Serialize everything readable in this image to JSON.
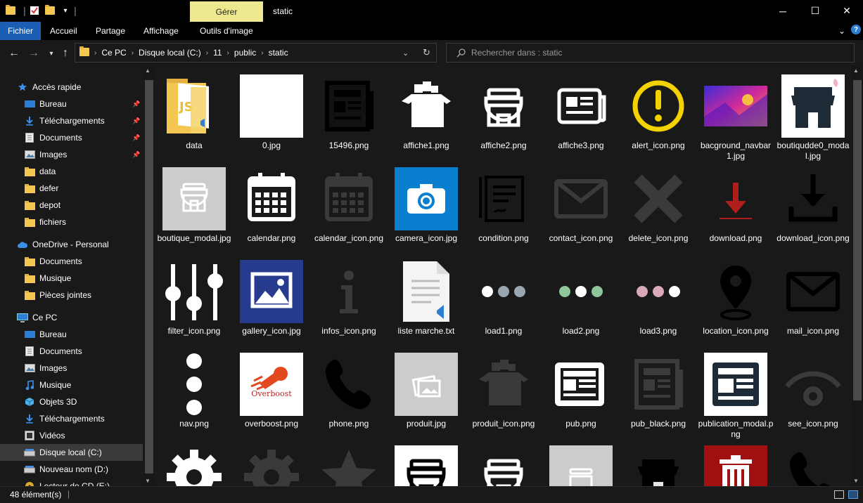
{
  "window": {
    "title": "static",
    "manage_tab": "Gérer",
    "minimize": "─",
    "maximize": "☐",
    "close": "✕"
  },
  "ribbon": {
    "tabs": [
      "Fichier",
      "Accueil",
      "Partage",
      "Affichage",
      "Outils d'image"
    ]
  },
  "address": {
    "crumbs": [
      "Ce PC",
      "Disque local (C:)",
      "11",
      "public",
      "static"
    ]
  },
  "search": {
    "placeholder": "Rechercher dans : static"
  },
  "sidebar": {
    "items": [
      {
        "label": "Accès rapide",
        "icon": "star-icon"
      },
      {
        "label": "Bureau",
        "icon": "desktop-icon",
        "pinned": true
      },
      {
        "label": "Téléchargements",
        "icon": "download-icon",
        "pinned": true
      },
      {
        "label": "Documents",
        "icon": "document-icon",
        "pinned": true
      },
      {
        "label": "Images",
        "icon": "images-icon",
        "pinned": true
      },
      {
        "label": "data",
        "icon": "folder-icon"
      },
      {
        "label": "defer",
        "icon": "folder-icon"
      },
      {
        "label": "depot",
        "icon": "folder-icon"
      },
      {
        "label": "fichiers",
        "icon": "folder-icon"
      },
      {
        "label": "OneDrive - Personal",
        "icon": "cloud-icon"
      },
      {
        "label": "Documents",
        "icon": "folder-icon"
      },
      {
        "label": "Musique",
        "icon": "folder-icon"
      },
      {
        "label": "Pièces jointes",
        "icon": "folder-icon"
      },
      {
        "label": "Ce PC",
        "icon": "computer-icon"
      },
      {
        "label": "Bureau",
        "icon": "desktop-icon"
      },
      {
        "label": "Documents",
        "icon": "document-icon"
      },
      {
        "label": "Images",
        "icon": "images-icon"
      },
      {
        "label": "Musique",
        "icon": "music-icon"
      },
      {
        "label": "Objets 3D",
        "icon": "cube-icon"
      },
      {
        "label": "Téléchargements",
        "icon": "download-icon"
      },
      {
        "label": "Vidéos",
        "icon": "video-icon"
      },
      {
        "label": "Disque local (C:)",
        "icon": "drive-icon",
        "selected": true
      },
      {
        "label": "Nouveau nom (D:)",
        "icon": "drive-icon"
      },
      {
        "label": "Lecteur de CD (E:)",
        "icon": "cd-icon"
      }
    ]
  },
  "files": [
    {
      "name": "data",
      "icon": "folder-icon"
    },
    {
      "name": "0.jpg",
      "icon": "white-image-icon"
    },
    {
      "name": "15496.png",
      "icon": "newspaper-icon"
    },
    {
      "name": "affiche1.png",
      "icon": "box-icon"
    },
    {
      "name": "affiche2.png",
      "icon": "shop-icon"
    },
    {
      "name": "affiche3.png",
      "icon": "newspaper-icon"
    },
    {
      "name": "alert_icon.png",
      "icon": "alert-icon"
    },
    {
      "name": "bacground_navbar1.jpg",
      "icon": "gradient-image-icon"
    },
    {
      "name": "boutiqudde0_modal.jpg",
      "icon": "shop-icon"
    },
    {
      "name": "boutique_modal.jpg",
      "icon": "shop-icon"
    },
    {
      "name": "calendar.png",
      "icon": "calendar-icon"
    },
    {
      "name": "calendar_icon.png",
      "icon": "calendar-icon"
    },
    {
      "name": "camera_icon.jpg",
      "icon": "camera-icon"
    },
    {
      "name": "condition.png",
      "icon": "contract-icon"
    },
    {
      "name": "contact_icon.png",
      "icon": "mail-icon"
    },
    {
      "name": "delete_icon.png",
      "icon": "delete-icon"
    },
    {
      "name": "download.png",
      "icon": "download-icon"
    },
    {
      "name": "download_icon.png",
      "icon": "download-icon"
    },
    {
      "name": "filter_icon.png",
      "icon": "filter-icon"
    },
    {
      "name": "gallery_icon.jpg",
      "icon": "gallery-icon"
    },
    {
      "name": "infos_icon.png",
      "icon": "info-icon"
    },
    {
      "name": "liste marche.txt",
      "icon": "text-file-icon"
    },
    {
      "name": "load1.png",
      "icon": "loader-icon"
    },
    {
      "name": "load2.png",
      "icon": "loader-icon"
    },
    {
      "name": "load3.png",
      "icon": "loader-icon"
    },
    {
      "name": "location_icon.png",
      "icon": "location-icon"
    },
    {
      "name": "mail_icon.png",
      "icon": "mail-icon"
    },
    {
      "name": "nav.png",
      "icon": "dots-vertical-icon"
    },
    {
      "name": "overboost.png",
      "icon": "overboost-logo-icon"
    },
    {
      "name": "phone.png",
      "icon": "phone-icon"
    },
    {
      "name": "produit.jpg",
      "icon": "image-placeholder-icon"
    },
    {
      "name": "produit_icon.png",
      "icon": "box-icon"
    },
    {
      "name": "pub.png",
      "icon": "newspaper-icon"
    },
    {
      "name": "pub_black.png",
      "icon": "newspaper-icon"
    },
    {
      "name": "publication_modal.png",
      "icon": "newspaper-icon"
    },
    {
      "name": "see_icon.png",
      "icon": "eye-icon"
    },
    {
      "name": "",
      "icon": "gear-icon"
    },
    {
      "name": "",
      "icon": "gear-icon"
    },
    {
      "name": "",
      "icon": "star-icon"
    },
    {
      "name": "",
      "icon": "shop-icon"
    },
    {
      "name": "",
      "icon": "shop-icon"
    },
    {
      "name": "",
      "icon": "shop-icon"
    },
    {
      "name": "",
      "icon": "shop-icon"
    },
    {
      "name": "",
      "icon": "trash-icon"
    },
    {
      "name": "",
      "icon": "phone-icon"
    }
  ],
  "overboost_text": "Overboost",
  "status": {
    "count": "48 élément(s)"
  },
  "colors": {
    "accent": "#1a5fb4",
    "manage_tab": "#eee98e",
    "folder": "#f3c752",
    "background": "#191919"
  }
}
